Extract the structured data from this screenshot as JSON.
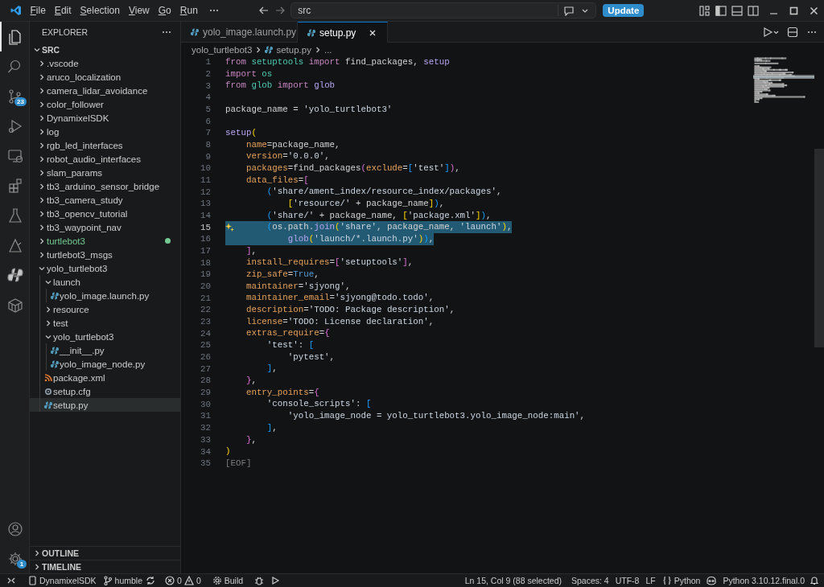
{
  "titlebar": {
    "menus": [
      "File",
      "Edit",
      "Selection",
      "View",
      "Go",
      "Run"
    ],
    "command_center": "src",
    "update_button": "Update"
  },
  "activity_bar": {
    "items": [
      {
        "selected": true
      },
      {
        "selected": false
      },
      {
        "selected": false,
        "badge": "23"
      },
      {
        "selected": false
      },
      {
        "selected": false
      },
      {
        "selected": false
      },
      {
        "selected": false
      },
      {
        "selected": false
      },
      {
        "selected": false
      },
      {
        "selected": false
      }
    ],
    "bottom": [
      {
        "selected": false
      },
      {
        "selected": false,
        "badge": "1"
      }
    ]
  },
  "explorer": {
    "title": "EXPLORER",
    "root": {
      "label": "SRC",
      "expanded": true
    },
    "items": [
      {
        "label": ".vscode",
        "kind": "folder",
        "expanded": false,
        "selected": false,
        "modified": false
      },
      {
        "label": "aruco_localization",
        "kind": "folder",
        "expanded": false,
        "selected": false,
        "modified": false
      },
      {
        "label": "camera_lidar_avoidance",
        "kind": "folder",
        "expanded": false,
        "selected": false,
        "modified": false
      },
      {
        "label": "color_follower",
        "kind": "folder",
        "expanded": false,
        "selected": false,
        "modified": false
      },
      {
        "label": "DynamixelSDK",
        "kind": "folder",
        "expanded": false,
        "selected": false,
        "modified": false
      },
      {
        "label": "log",
        "kind": "folder",
        "expanded": false,
        "selected": false,
        "modified": false
      },
      {
        "label": "rgb_led_interfaces",
        "kind": "folder",
        "expanded": false,
        "selected": false,
        "modified": false
      },
      {
        "label": "robot_audio_interfaces",
        "kind": "folder",
        "expanded": false,
        "selected": false,
        "modified": false
      },
      {
        "label": "slam_params",
        "kind": "folder",
        "expanded": false,
        "selected": false,
        "modified": false
      },
      {
        "label": "tb3_arduino_sensor_bridge",
        "kind": "folder",
        "expanded": false,
        "selected": false,
        "modified": false
      },
      {
        "label": "tb3_camera_study",
        "kind": "folder",
        "expanded": false,
        "selected": false,
        "modified": false
      },
      {
        "label": "tb3_opencv_tutorial",
        "kind": "folder",
        "expanded": false,
        "selected": false,
        "modified": false
      },
      {
        "label": "tb3_waypoint_nav",
        "kind": "folder",
        "expanded": false,
        "selected": false,
        "modified": false
      },
      {
        "label": "turtlebot3",
        "kind": "folder",
        "expanded": false,
        "selected": false,
        "modified": true
      },
      {
        "label": "turtlebot3_msgs",
        "kind": "folder",
        "expanded": false,
        "selected": false,
        "modified": false
      },
      {
        "label": "yolo_turtlebot3",
        "kind": "folder",
        "expanded": true,
        "selected": false,
        "modified": false,
        "children": [
          {
            "label": "launch",
            "kind": "folder",
            "expanded": true,
            "selected": false,
            "modified": false,
            "children": [
              {
                "label": "yolo_image.launch.py",
                "kind": "python",
                "selected": false,
                "modified": false
              }
            ]
          },
          {
            "label": "resource",
            "kind": "folder",
            "expanded": false,
            "selected": false,
            "modified": false
          },
          {
            "label": "test",
            "kind": "folder",
            "expanded": false,
            "selected": false,
            "modified": false
          },
          {
            "label": "yolo_turtlebot3",
            "kind": "folder",
            "expanded": true,
            "selected": false,
            "modified": false,
            "children": [
              {
                "label": "__init__.py",
                "kind": "python",
                "selected": false,
                "modified": false
              },
              {
                "label": "yolo_image_node.py",
                "kind": "python",
                "selected": false,
                "modified": false
              }
            ]
          },
          {
            "label": "package.xml",
            "kind": "xml",
            "selected": false,
            "modified": false
          },
          {
            "label": "setup.cfg",
            "kind": "config",
            "selected": false,
            "modified": false
          },
          {
            "label": "setup.py",
            "kind": "python",
            "selected": true,
            "modified": false
          }
        ]
      }
    ],
    "sections": [
      {
        "label": "OUTLINE",
        "expanded": false
      },
      {
        "label": "TIMELINE",
        "expanded": false
      }
    ]
  },
  "editor": {
    "tabs": [
      {
        "label": "yolo_image.launch.py",
        "selected": false
      },
      {
        "label": "setup.py",
        "selected": true
      }
    ],
    "breadcrumbs": [
      "yolo_turtlebot3",
      "setup.py",
      "..."
    ],
    "lines": [
      {
        "number": "1",
        "current": false,
        "selected": false,
        "tokens": [
          {
            "kind": "kw",
            "text": "from"
          },
          {
            "kind": "mod",
            "text": " setuptools"
          },
          {
            "kind": "kw",
            "text": " import"
          },
          {
            "kind": "p",
            "text": " find_packages, "
          },
          {
            "kind": "fn",
            "text": "setup"
          }
        ]
      },
      {
        "number": "2",
        "current": false,
        "selected": false,
        "tokens": [
          {
            "kind": "kw",
            "text": "import"
          },
          {
            "kind": "mod",
            "text": " os"
          }
        ]
      },
      {
        "number": "3",
        "current": false,
        "selected": false,
        "tokens": [
          {
            "kind": "kw",
            "text": "from"
          },
          {
            "kind": "mod",
            "text": " glob"
          },
          {
            "kind": "kw",
            "text": " import"
          },
          {
            "kind": "fn",
            "text": " glob"
          }
        ]
      },
      {
        "number": "4",
        "current": false,
        "selected": false
      },
      {
        "number": "5",
        "current": false,
        "selected": false,
        "tokens": [
          {
            "kind": "p",
            "text": "package_name = "
          },
          {
            "kind": "str",
            "text": "'yolo_turtlebot3'"
          }
        ]
      },
      {
        "number": "6",
        "current": false,
        "selected": false
      },
      {
        "number": "7",
        "current": false,
        "selected": false,
        "tokens": [
          {
            "kind": "fn",
            "text": "setup"
          },
          {
            "kind": "b1",
            "text": "("
          }
        ]
      },
      {
        "number": "8",
        "current": false,
        "selected": false,
        "tokens": [
          {
            "kind": "param",
            "text": "    name"
          },
          {
            "kind": "p",
            "text": "=package_name,"
          }
        ]
      },
      {
        "number": "9",
        "current": false,
        "selected": false,
        "tokens": [
          {
            "kind": "param",
            "text": "    version"
          },
          {
            "kind": "p",
            "text": "="
          },
          {
            "kind": "str",
            "text": "'0.0.0'"
          },
          {
            "kind": "p",
            "text": ","
          }
        ]
      },
      {
        "number": "10",
        "current": false,
        "selected": false,
        "tokens": [
          {
            "kind": "param",
            "text": "    packages"
          },
          {
            "kind": "p",
            "text": "=find_packages"
          },
          {
            "kind": "b2",
            "text": "("
          },
          {
            "kind": "param",
            "text": "exclude"
          },
          {
            "kind": "p",
            "text": "="
          },
          {
            "kind": "b3",
            "text": "["
          },
          {
            "kind": "str",
            "text": "'test'"
          },
          {
            "kind": "b3",
            "text": "]"
          },
          {
            "kind": "b2",
            "text": ")"
          },
          {
            "kind": "p",
            "text": ","
          }
        ]
      },
      {
        "number": "11",
        "current": false,
        "selected": false,
        "tokens": [
          {
            "kind": "param",
            "text": "    data_files"
          },
          {
            "kind": "p",
            "text": "="
          },
          {
            "kind": "b2",
            "text": "["
          }
        ]
      },
      {
        "number": "12",
        "current": false,
        "selected": false,
        "tokens": [
          {
            "kind": "b3",
            "text": "        ("
          },
          {
            "kind": "str",
            "text": "'share/ament_index/resource_index/packages'"
          },
          {
            "kind": "p",
            "text": ","
          }
        ]
      },
      {
        "number": "13",
        "current": false,
        "selected": false,
        "tokens": [
          {
            "kind": "b1",
            "text": "            ["
          },
          {
            "kind": "str",
            "text": "'resource/'"
          },
          {
            "kind": "p",
            "text": " + package_name"
          },
          {
            "kind": "b1",
            "text": "]"
          },
          {
            "kind": "b3",
            "text": ")"
          },
          {
            "kind": "p",
            "text": ","
          }
        ]
      },
      {
        "number": "14",
        "current": false,
        "selected": false,
        "tokens": [
          {
            "kind": "b3",
            "text": "        ("
          },
          {
            "kind": "str",
            "text": "'share/'"
          },
          {
            "kind": "p",
            "text": " + package_name, "
          },
          {
            "kind": "b1",
            "text": "["
          },
          {
            "kind": "str",
            "text": "'package.xml'"
          },
          {
            "kind": "b1",
            "text": "]"
          },
          {
            "kind": "b3",
            "text": ")"
          },
          {
            "kind": "p",
            "text": ","
          }
        ]
      },
      {
        "number": "15",
        "current": true,
        "selected": true,
        "tokens": [
          {
            "kind": "b3",
            "text": "        ("
          },
          {
            "kind": "p",
            "text": "os.path."
          },
          {
            "kind": "fn",
            "text": "join"
          },
          {
            "kind": "b1",
            "text": "("
          },
          {
            "kind": "str",
            "text": "'share'"
          },
          {
            "kind": "p",
            "text": ", package_name, "
          },
          {
            "kind": "str",
            "text": "'launch'"
          },
          {
            "kind": "b1",
            "text": ")"
          },
          {
            "kind": "p",
            "text": ","
          }
        ]
      },
      {
        "number": "16",
        "current": false,
        "selected": true,
        "tokens": [
          {
            "kind": "fn",
            "text": "            glob"
          },
          {
            "kind": "b1",
            "text": "("
          },
          {
            "kind": "str",
            "text": "'launch/*.launch.py'"
          },
          {
            "kind": "b1",
            "text": ")"
          },
          {
            "kind": "b3",
            "text": ")"
          },
          {
            "kind": "p",
            "text": ","
          }
        ]
      },
      {
        "number": "17",
        "current": false,
        "selected": false,
        "tokens": [
          {
            "kind": "b2",
            "text": "    ]"
          },
          {
            "kind": "p",
            "text": ","
          }
        ]
      },
      {
        "number": "18",
        "current": false,
        "selected": false,
        "tokens": [
          {
            "kind": "param",
            "text": "    install_requires"
          },
          {
            "kind": "p",
            "text": "="
          },
          {
            "kind": "b2",
            "text": "["
          },
          {
            "kind": "str",
            "text": "'setuptools'"
          },
          {
            "kind": "b2",
            "text": "]"
          },
          {
            "kind": "p",
            "text": ","
          }
        ]
      },
      {
        "number": "19",
        "current": false,
        "selected": false,
        "tokens": [
          {
            "kind": "param",
            "text": "    zip_safe"
          },
          {
            "kind": "p",
            "text": "="
          },
          {
            "kind": "const",
            "text": "True"
          },
          {
            "kind": "p",
            "text": ","
          }
        ]
      },
      {
        "number": "20",
        "current": false,
        "selected": false,
        "tokens": [
          {
            "kind": "param",
            "text": "    maintainer"
          },
          {
            "kind": "p",
            "text": "="
          },
          {
            "kind": "str",
            "text": "'sjyong'"
          },
          {
            "kind": "p",
            "text": ","
          }
        ]
      },
      {
        "number": "21",
        "current": false,
        "selected": false,
        "tokens": [
          {
            "kind": "param",
            "text": "    maintainer_email"
          },
          {
            "kind": "p",
            "text": "="
          },
          {
            "kind": "str",
            "text": "'sjyong@todo.todo'"
          },
          {
            "kind": "p",
            "text": ","
          }
        ]
      },
      {
        "number": "22",
        "current": false,
        "selected": false,
        "tokens": [
          {
            "kind": "param",
            "text": "    description"
          },
          {
            "kind": "p",
            "text": "="
          },
          {
            "kind": "str",
            "text": "'TODO: Package description'"
          },
          {
            "kind": "p",
            "text": ","
          }
        ]
      },
      {
        "number": "23",
        "current": false,
        "selected": false,
        "tokens": [
          {
            "kind": "param",
            "text": "    license"
          },
          {
            "kind": "p",
            "text": "="
          },
          {
            "kind": "str",
            "text": "'TODO: License declaration'"
          },
          {
            "kind": "p",
            "text": ","
          }
        ]
      },
      {
        "number": "24",
        "current": false,
        "selected": false,
        "tokens": [
          {
            "kind": "param",
            "text": "    extras_require"
          },
          {
            "kind": "p",
            "text": "="
          },
          {
            "kind": "b2",
            "text": "{"
          }
        ]
      },
      {
        "number": "25",
        "current": false,
        "selected": false,
        "tokens": [
          {
            "kind": "str",
            "text": "        'test'"
          },
          {
            "kind": "p",
            "text": ": "
          },
          {
            "kind": "b3",
            "text": "["
          }
        ]
      },
      {
        "number": "26",
        "current": false,
        "selected": false,
        "tokens": [
          {
            "kind": "str",
            "text": "            'pytest'"
          },
          {
            "kind": "p",
            "text": ","
          }
        ]
      },
      {
        "number": "27",
        "current": false,
        "selected": false,
        "tokens": [
          {
            "kind": "b3",
            "text": "        ]"
          },
          {
            "kind": "p",
            "text": ","
          }
        ]
      },
      {
        "number": "28",
        "current": false,
        "selected": false,
        "tokens": [
          {
            "kind": "b2",
            "text": "    }"
          },
          {
            "kind": "p",
            "text": ","
          }
        ]
      },
      {
        "number": "29",
        "current": false,
        "selected": false,
        "tokens": [
          {
            "kind": "param",
            "text": "    entry_points"
          },
          {
            "kind": "p",
            "text": "="
          },
          {
            "kind": "b2",
            "text": "{"
          }
        ]
      },
      {
        "number": "30",
        "current": false,
        "selected": false,
        "tokens": [
          {
            "kind": "str",
            "text": "        'console_scripts'"
          },
          {
            "kind": "p",
            "text": ": "
          },
          {
            "kind": "b3",
            "text": "["
          }
        ]
      },
      {
        "number": "31",
        "current": false,
        "selected": false,
        "tokens": [
          {
            "kind": "str",
            "text": "            'yolo_image_node = yolo_turtlebot3.yolo_image_node:main'"
          },
          {
            "kind": "p",
            "text": ","
          }
        ]
      },
      {
        "number": "32",
        "current": false,
        "selected": false,
        "tokens": [
          {
            "kind": "b3",
            "text": "        ]"
          },
          {
            "kind": "p",
            "text": ","
          }
        ]
      },
      {
        "number": "33",
        "current": false,
        "selected": false,
        "tokens": [
          {
            "kind": "b2",
            "text": "    }"
          },
          {
            "kind": "p",
            "text": ","
          }
        ]
      },
      {
        "number": "34",
        "current": false,
        "selected": false,
        "tokens": [
          {
            "kind": "b1",
            "text": ")"
          }
        ]
      },
      {
        "number": "35",
        "current": false,
        "selected": false,
        "tokens": [
          {
            "kind": "eof",
            "text": "[EOF]"
          }
        ]
      }
    ]
  },
  "status_bar": {
    "folder": "DynamixelSDK",
    "branch": "humble",
    "errors": "0",
    "warnings": "0",
    "task": "Build",
    "cursor": "Ln 15, Col 9 (88 selected)",
    "indent": "Spaces: 4",
    "encoding": "UTF-8",
    "eol": "LF",
    "language": "Python",
    "interpreter": "Python 3.10.12.final.0"
  }
}
